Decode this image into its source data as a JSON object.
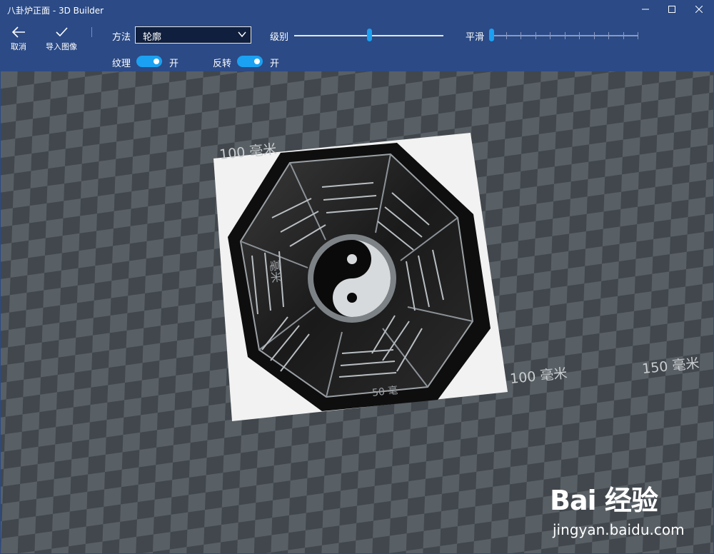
{
  "window": {
    "title": "八卦炉正面 - 3D Builder"
  },
  "toolbar": {
    "cancel_label": "取消",
    "import_label": "导入图像",
    "method_label": "方法",
    "method_value": "轮廓",
    "level_label": "级别",
    "level_value": 0.5,
    "smooth_label": "平滑",
    "smooth_value": 0,
    "texture_label": "纹理",
    "texture_state": "开",
    "invert_label": "反转",
    "invert_state": "开"
  },
  "viewport": {
    "dim_top": "100 毫米",
    "dim_right": "100 毫米",
    "dim_far": "150 毫米",
    "dim_bottom_partial": "50 毫",
    "dim_side_partial": "毫米"
  },
  "watermark": {
    "brand": "Bai 经验",
    "url": "jingyan.baidu.com"
  },
  "colors": {
    "header_bg": "#2b4a86",
    "accent": "#1ba1f2",
    "grid_light": "#585f65",
    "grid_dark": "#41474d"
  }
}
